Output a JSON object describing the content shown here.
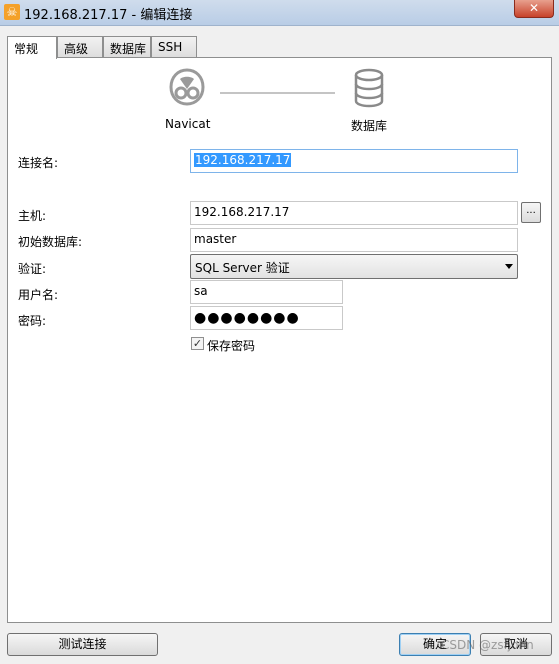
{
  "window": {
    "title": "192.168.217.17 - 编辑连接",
    "app_icon_glyph": "☠",
    "close_glyph": "✕"
  },
  "tabs": [
    {
      "label": "常规",
      "active": true
    },
    {
      "label": "高级",
      "active": false
    },
    {
      "label": "数据库",
      "active": false
    },
    {
      "label": "SSH",
      "active": false
    }
  ],
  "diagram": {
    "left_caption": "Navicat",
    "right_caption": "数据库",
    "left_icon": "navicat-logo-icon",
    "right_icon": "database-icon"
  },
  "form": {
    "connection_name": {
      "label": "连接名:",
      "value": "192.168.217.17"
    },
    "host": {
      "label": "主机:",
      "value": "192.168.217.17",
      "browse_label": "..."
    },
    "initial_database": {
      "label": "初始数据库:",
      "value": "master"
    },
    "auth": {
      "label": "验证:",
      "value": "SQL Server 验证"
    },
    "username": {
      "label": "用户名:",
      "value": "sa"
    },
    "password": {
      "label": "密码:",
      "value": "●●●●●●●●"
    },
    "save_password": {
      "label": "保存密码",
      "checked": true,
      "check_glyph": "✓"
    }
  },
  "buttons": {
    "test": "测试连接",
    "ok": "确定",
    "cancel": "取消"
  },
  "watermark": "CSDN @zsfjohn",
  "colors": {
    "selection": "#3399ff",
    "focus_border": "#7eb4ea",
    "app_icon": "#f4a12a",
    "close_button": "#c7422a"
  }
}
